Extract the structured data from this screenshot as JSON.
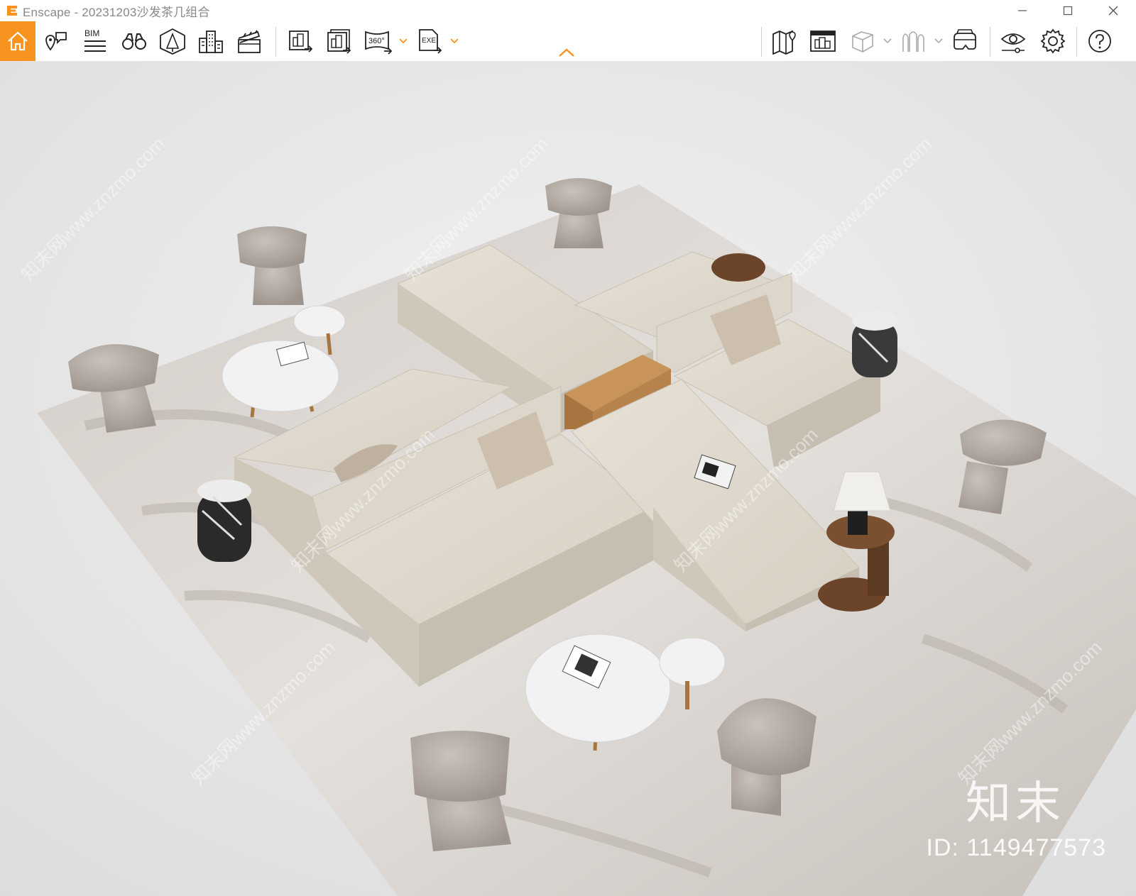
{
  "window": {
    "title": "Enscape - 20231203沙发茶几组合",
    "brand_color": "#f7931e"
  },
  "toolbar": {
    "bim_label": "BIM",
    "pano_label": "360°",
    "exe_label": "EXE",
    "left_icons": [
      "home-icon",
      "view-management-icon",
      "bim-icon",
      "binoculars-icon",
      "asset-library-icon",
      "buildings-icon",
      "video-editor-icon",
      "render-screenshot-icon",
      "batch-render-icon",
      "render-360-icon",
      "export-exe-icon"
    ],
    "right_icons": [
      "map-icon",
      "atmosphere-icon",
      "cube-view-icon",
      "walk-mode-icon",
      "vr-headset-icon",
      "visual-settings-icon",
      "settings-icon",
      "help-icon"
    ]
  },
  "viewport": {
    "scene": "3D render of modular sofa and coffee table set",
    "watermark_text": "知末网www.znzmo.com",
    "watermark_logo": "知末",
    "watermark_id": "ID: 1149477573"
  }
}
